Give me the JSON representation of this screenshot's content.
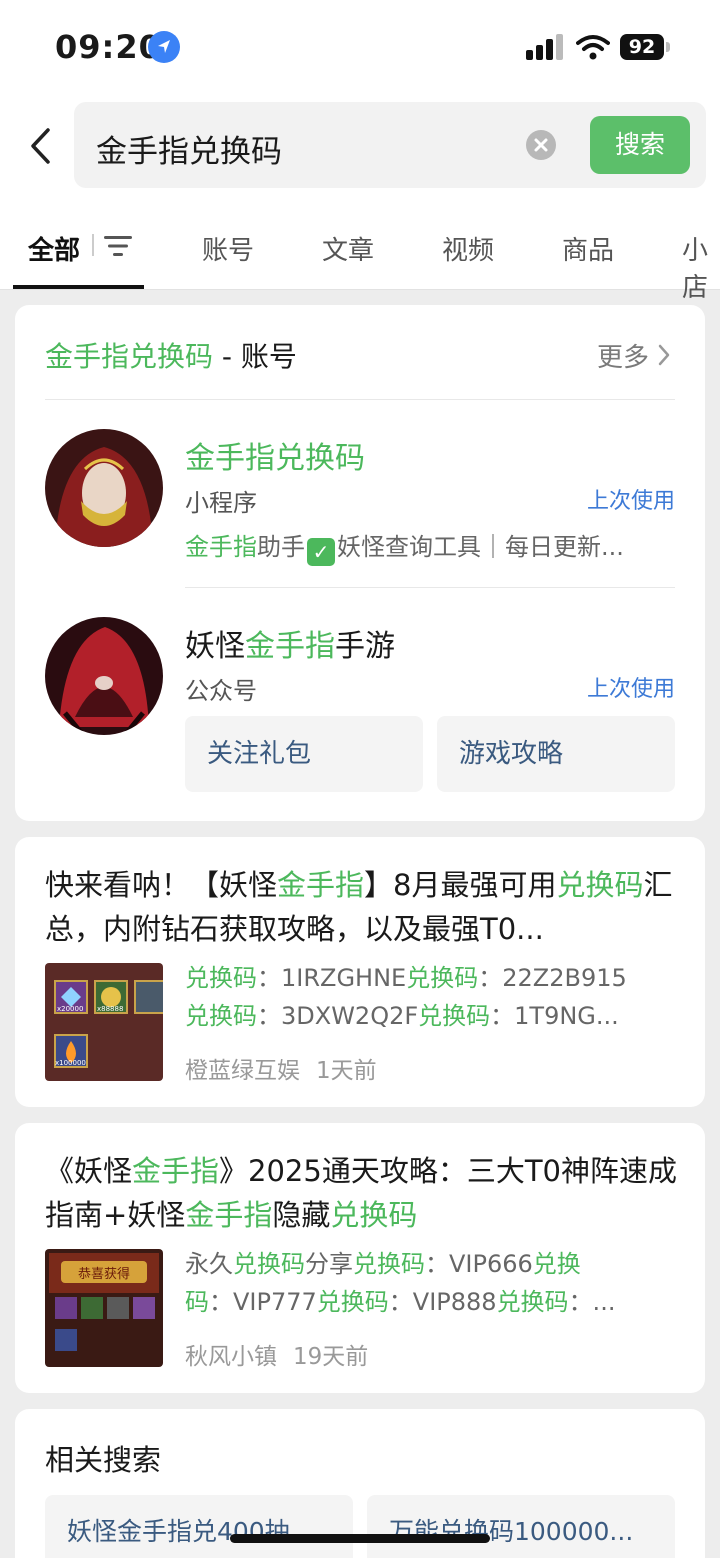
{
  "status_bar": {
    "time": "09:20",
    "battery": "92"
  },
  "search": {
    "query": "金手指兑换码",
    "button_label": "搜索"
  },
  "tabs": [
    {
      "label": "全部",
      "active": true
    },
    {
      "label": "账号"
    },
    {
      "label": "文章"
    },
    {
      "label": "视频"
    },
    {
      "label": "商品"
    },
    {
      "label": "小店"
    }
  ],
  "accounts_section": {
    "title_highlight": "金手指兑换码",
    "title_suffix": " - 账号",
    "more_label": "更多",
    "items": [
      {
        "name": "金手指兑换码",
        "type": "小程序",
        "badge": "上次使用",
        "desc_highlight": "金手指",
        "desc_mid": "助手",
        "desc_rest": "妖怪查询工具｜每日更新..."
      },
      {
        "name_pre": "妖怪",
        "name_highlight": "金手指",
        "name_post": "手游",
        "type": "公众号",
        "badge": "上次使用",
        "buttons": [
          "关注礼包",
          "游戏攻略"
        ]
      }
    ]
  },
  "articles": [
    {
      "title_parts": [
        "快来看呐！【妖怪",
        "金手指",
        "】8月最强可用",
        "兑换码",
        "汇总，内附钻石获取攻略，以及最强T0..."
      ],
      "snippet_lines": [
        [
          "兑换码",
          "：1IRZGHNE",
          "兑换码",
          "：22Z2B915"
        ],
        [
          "兑换码",
          "：3DXW2Q2F",
          "兑换码",
          "：1T9NG..."
        ]
      ],
      "source": "橙蓝绿互娱",
      "time": "1天前",
      "thumb_labels": [
        "x20000",
        "x88888",
        "x100000"
      ]
    },
    {
      "title_parts": [
        "《妖怪",
        "金手指",
        "》2025通天攻略：三大T0神阵速成指南+妖怪",
        "金手指",
        "隐藏",
        "兑换码"
      ],
      "snippet_lines": [
        [
          "永久",
          "兑换码",
          "分享",
          "兑换码",
          "：VIP666",
          "兑换"
        ],
        [
          "码",
          "：VIP777",
          "兑换码",
          "：VIP888",
          "兑换码",
          "：..."
        ]
      ],
      "source": "秋风小镇",
      "time": "19天前",
      "thumb_labels": [
        "恭喜获得"
      ]
    }
  ],
  "related": {
    "title": "相关搜索",
    "items": [
      "妖怪金手指兑400抽",
      "万能兑换码100000..."
    ]
  },
  "colors": {
    "highlight": "#4cb85c",
    "link_blue": "#3d7ad6",
    "button_green": "#5cbf6a"
  }
}
